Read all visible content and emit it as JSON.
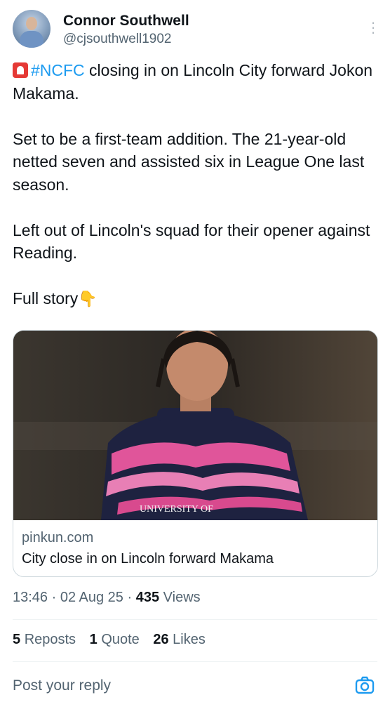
{
  "tweet": {
    "author_name": "Connor Southwell",
    "author_handle": "@cjsouthwell1902",
    "hashtag": "#NCFC",
    "line1_rest": " closing in on Lincoln City forward Jokon Makama.",
    "para2": "Set to be a first-team addition. The 21-year-old netted seven and assisted six in League One last season.",
    "para3": "Left out of Lincoln's squad for their opener against Reading.",
    "para4": "Full story",
    "siren_icon": "siren-emoji",
    "pointing_icon": "backhand-index-pointing-down-emoji"
  },
  "card": {
    "domain": "pinkun.com",
    "title": "City close in on Lincoln forward Makama",
    "image_alt": "Player in pink and navy Lincoln City shirt",
    "shirt_text": "UNIVERSITY OF"
  },
  "meta": {
    "time": "13:46",
    "date": "02 Aug 25",
    "views_count": "435",
    "views_label": "Views"
  },
  "stats": {
    "reposts_count": "5",
    "reposts_label": "Reposts",
    "quote_count": "1",
    "quote_label": "Quote",
    "likes_count": "26",
    "likes_label": "Likes"
  },
  "reply": {
    "placeholder": "Post your reply",
    "camera_icon": "camera-icon"
  },
  "colors": {
    "link": "#1d9bf0",
    "secondary": "#536471",
    "primary": "#0f1419"
  }
}
